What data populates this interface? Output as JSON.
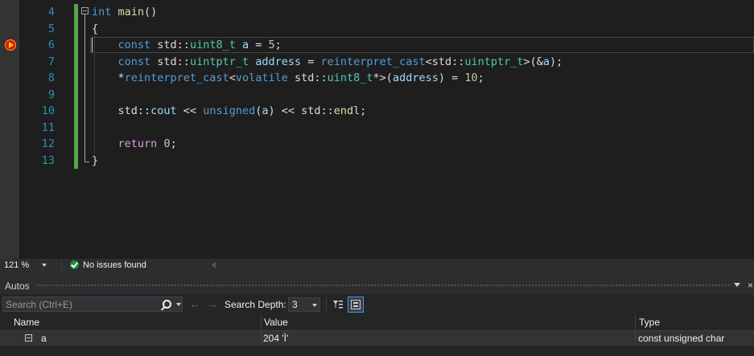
{
  "editor": {
    "lines": [
      {
        "number": "4",
        "tokens": [
          {
            "t": "int",
            "c": "kw"
          },
          {
            "t": " "
          },
          {
            "t": "main",
            "c": "fn"
          },
          {
            "t": "()"
          }
        ]
      },
      {
        "number": "5",
        "tokens": [
          {
            "t": "{"
          }
        ]
      },
      {
        "number": "6",
        "tokens": [
          {
            "t": "    "
          },
          {
            "t": "const",
            "c": "kw"
          },
          {
            "t": " std::"
          },
          {
            "t": "uint8_t",
            "c": "ty"
          },
          {
            "t": " "
          },
          {
            "t": "a",
            "c": "var"
          },
          {
            "t": " = "
          },
          {
            "t": "5",
            "c": "num"
          },
          {
            "t": ";"
          }
        ]
      },
      {
        "number": "7",
        "tokens": [
          {
            "t": "    "
          },
          {
            "t": "const",
            "c": "kw"
          },
          {
            "t": " std::"
          },
          {
            "t": "uintptr_t",
            "c": "ty"
          },
          {
            "t": " "
          },
          {
            "t": "address",
            "c": "var"
          },
          {
            "t": " = "
          },
          {
            "t": "reinterpret_cast",
            "c": "cast"
          },
          {
            "t": "<std::"
          },
          {
            "t": "uintptr_t",
            "c": "ty"
          },
          {
            "t": ">(&"
          },
          {
            "t": "a",
            "c": "var"
          },
          {
            "t": ");"
          }
        ]
      },
      {
        "number": "8",
        "tokens": [
          {
            "t": "    *"
          },
          {
            "t": "reinterpret_cast",
            "c": "cast"
          },
          {
            "t": "<"
          },
          {
            "t": "volatile",
            "c": "kw"
          },
          {
            "t": " std::"
          },
          {
            "t": "uint8_t",
            "c": "ty"
          },
          {
            "t": "*>("
          },
          {
            "t": "address",
            "c": "var"
          },
          {
            "t": ") = "
          },
          {
            "t": "10",
            "c": "num"
          },
          {
            "t": ";"
          }
        ]
      },
      {
        "number": "9",
        "tokens": []
      },
      {
        "number": "10",
        "tokens": [
          {
            "t": "    std::"
          },
          {
            "t": "cout",
            "c": "var"
          },
          {
            "t": " << "
          },
          {
            "t": "unsigned",
            "c": "kw"
          },
          {
            "t": "("
          },
          {
            "t": "a",
            "c": "var"
          },
          {
            "t": ") << std::"
          },
          {
            "t": "endl",
            "c": "fn"
          },
          {
            "t": ";"
          }
        ]
      },
      {
        "number": "11",
        "tokens": []
      },
      {
        "number": "12",
        "tokens": [
          {
            "t": "    "
          },
          {
            "t": "return",
            "c": "ctl"
          },
          {
            "t": " "
          },
          {
            "t": "0",
            "c": "num"
          },
          {
            "t": ";"
          }
        ]
      },
      {
        "number": "13",
        "tokens": [
          {
            "t": "}"
          }
        ]
      }
    ],
    "breakpoint_line": "6"
  },
  "statusbar": {
    "zoom": "121 %",
    "issues": "No issues found"
  },
  "autos": {
    "title": "Autos",
    "close_glyph": "×",
    "search_placeholder": "Search (Ctrl+E)",
    "back_glyph": "←",
    "forward_glyph": "→",
    "search_depth_label": "Search Depth:",
    "search_depth_value": "3",
    "columns": {
      "name": "Name",
      "value": "Value",
      "type": "Type"
    },
    "rows": [
      {
        "name": "a",
        "value": "204 'Ì'",
        "type": "const unsigned char"
      }
    ]
  },
  "colors": {
    "editor_bg": "#1e1e1e",
    "keyword": "#569cd6",
    "type": "#4ec9b0",
    "function": "#dcdcaa",
    "number": "#b5cea8",
    "variable": "#9cdcfe",
    "control": "#d8a0df",
    "line_number": "#2b91af",
    "change_bar": "#57a64a",
    "breakpoint": "#e51400"
  },
  "icons": [
    "breakpoint-icon",
    "collapse-icon",
    "check-circle-icon",
    "magnifier-icon",
    "chevron-down-icon",
    "arrow-left-icon",
    "arrow-right-icon",
    "filter-icon",
    "hex-display-icon",
    "pin-icon",
    "close-icon",
    "expand-icon"
  ]
}
